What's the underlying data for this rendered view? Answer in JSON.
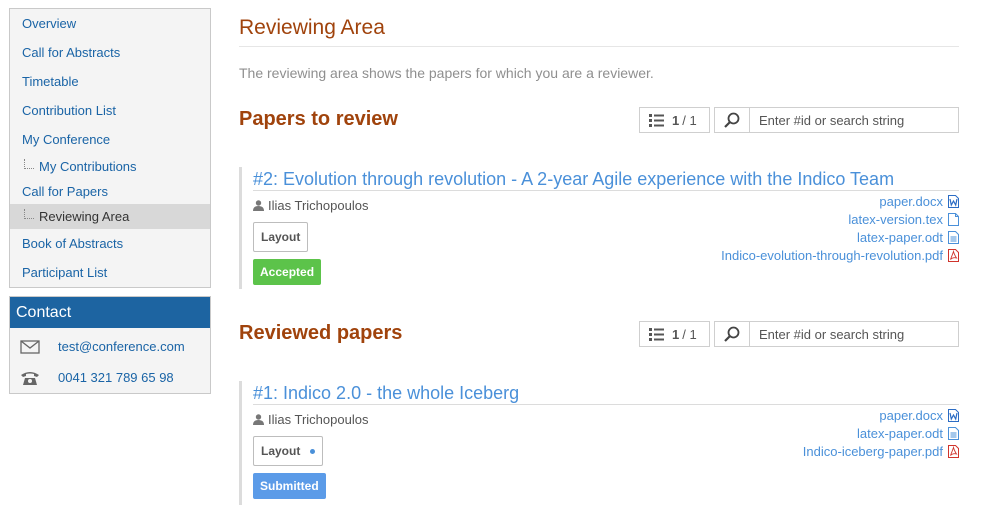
{
  "sidebar": {
    "items": [
      {
        "label": "Overview"
      },
      {
        "label": "Call for Abstracts"
      },
      {
        "label": "Timetable"
      },
      {
        "label": "Contribution List"
      },
      {
        "label": "My Conference"
      },
      {
        "label": "My Contributions"
      },
      {
        "label": "Call for Papers"
      },
      {
        "label": "Reviewing Area"
      },
      {
        "label": "Book of Abstracts"
      },
      {
        "label": "Participant List"
      }
    ]
  },
  "contact": {
    "title": "Contact",
    "email": "test@conference.com",
    "phone": "0041 321 789 65 98"
  },
  "main": {
    "title": "Reviewing Area",
    "description": "The reviewing area shows the papers for which you are a reviewer.",
    "sections": [
      {
        "title": "Papers to review",
        "pager": {
          "current": "1",
          "total": "/ 1"
        },
        "search_placeholder": "Enter #id or search string",
        "paper": {
          "title": "#2: Evolution through revolution - A 2-year Agile experience with the Indico Team",
          "author": "Ilias Trichopoulos",
          "layout_label": "Layout",
          "state": "Accepted",
          "files": [
            "paper.docx",
            "latex-version.tex",
            "latex-paper.odt",
            "Indico-evolution-through-revolution.pdf"
          ]
        }
      },
      {
        "title": "Reviewed papers",
        "pager": {
          "current": "1",
          "total": "/ 1"
        },
        "search_placeholder": "Enter #id or search string",
        "paper": {
          "title": "#1: Indico 2.0 - the whole Iceberg",
          "author": "Ilias Trichopoulos",
          "layout_label": "Layout",
          "state": "Submitted",
          "files": [
            "paper.docx",
            "latex-paper.odt",
            "Indico-iceberg-paper.pdf"
          ]
        }
      }
    ]
  }
}
